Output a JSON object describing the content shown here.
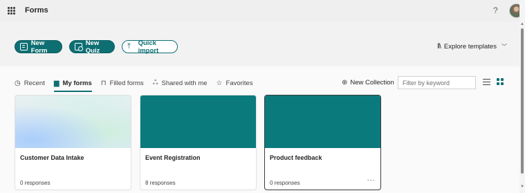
{
  "header": {
    "app_title": "Forms",
    "help_label": "?"
  },
  "actions": {
    "new_form": "New Form",
    "new_quiz": "New Quiz",
    "quick_import": "Quick import",
    "explore_templates": "Explore templates"
  },
  "tabs": [
    {
      "label": "Recent",
      "icon": "clock-icon",
      "active": false
    },
    {
      "label": "My forms",
      "icon": "document-icon",
      "active": true
    },
    {
      "label": "Filled forms",
      "icon": "bookmark-icon",
      "active": false
    },
    {
      "label": "Shared with me",
      "icon": "people-icon",
      "active": false
    },
    {
      "label": "Favorites",
      "icon": "star-icon",
      "active": false
    }
  ],
  "toolbar": {
    "new_collection": "New Collection",
    "filter_placeholder": "Filter by keyword"
  },
  "cards": [
    {
      "title": "Customer Data Intake",
      "responses": "0 responses",
      "thumbnail": "gradient"
    },
    {
      "title": "Event Registration",
      "responses": "8 responses",
      "thumbnail": "teal"
    },
    {
      "title": "Product feedback",
      "responses": "0 responses",
      "thumbnail": "teal",
      "selected": true,
      "more_label": "···"
    }
  ],
  "colors": {
    "accent": "#0e6f73",
    "card_teal": "#0b7a7d"
  }
}
